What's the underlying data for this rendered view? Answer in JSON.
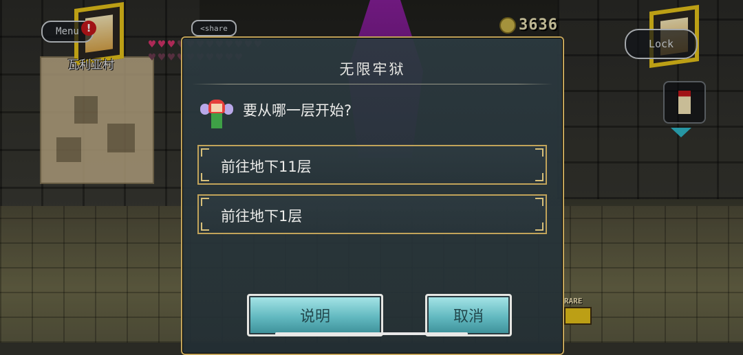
{
  "hud": {
    "menu_label": "Menu",
    "share_label": "share",
    "location": "瓦利亚村",
    "coins": "3636",
    "lock_label": "Lock",
    "rare_label": "RARE"
  },
  "hearts": {
    "full": 3,
    "total": 22
  },
  "dialog": {
    "title": "无限牢狱",
    "question": "要从哪一层开始?",
    "options": [
      {
        "label": "前往地下11层"
      },
      {
        "label": "前往地下1层"
      }
    ],
    "explain_label": "说明",
    "cancel_label": "取消"
  },
  "colors": {
    "frame_gold": "#c2a45a",
    "button_teal": "#62b9c0",
    "portrait_gold": "#e6c21a",
    "crystal_purple": "#9a1fb0"
  }
}
